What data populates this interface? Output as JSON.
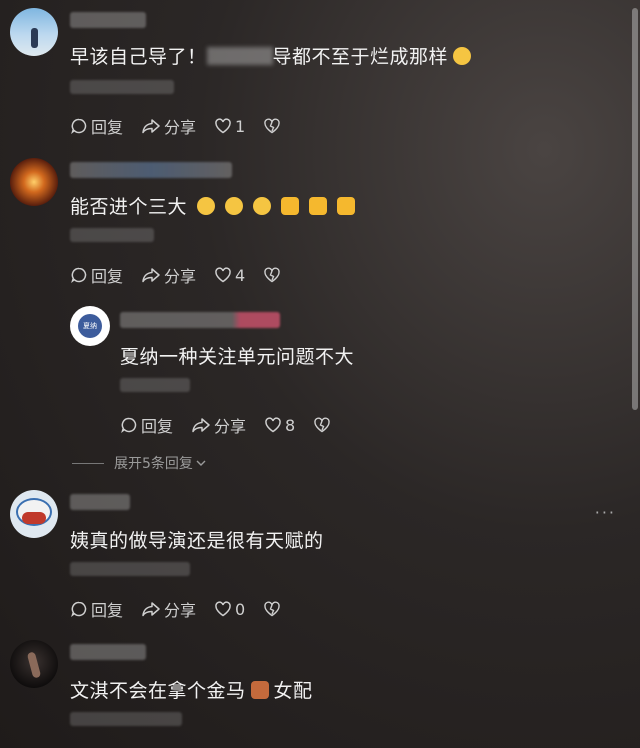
{
  "comments": [
    {
      "text_a": "早该自己导了！",
      "text_b": "导都不至于烂成那样",
      "likes": "1"
    },
    {
      "text": "能否进个三大",
      "likes": "4",
      "reply": {
        "avatar_text": "夏纳",
        "text": "夏纳一种关注单元问题不大",
        "likes": "8"
      },
      "expand_label": "展开5条回复"
    },
    {
      "text": "姨真的做导演还是很有天赋的",
      "likes": "0"
    },
    {
      "text_a": "文淇不会在拿个金马",
      "text_b": "女配"
    }
  ],
  "labels": {
    "reply": "回复",
    "share": "分享"
  },
  "more_label": "···",
  "colors": {
    "accent": "#f0c13a",
    "bg": "#2b2726"
  }
}
